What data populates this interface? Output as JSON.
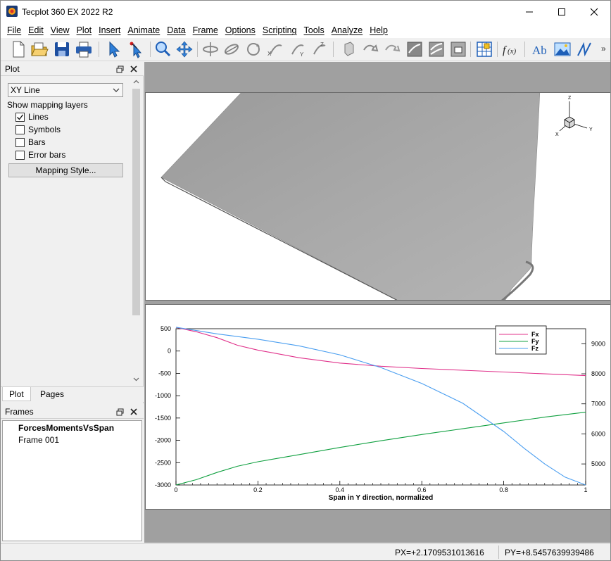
{
  "window": {
    "title": "Tecplot 360 EX 2022 R2"
  },
  "menu": [
    "File",
    "Edit",
    "View",
    "Plot",
    "Insert",
    "Animate",
    "Data",
    "Frame",
    "Options",
    "Scripting",
    "Tools",
    "Analyze",
    "Help"
  ],
  "toolbar": {
    "icons": [
      "new-layout-icon",
      "open-layout-icon",
      "save-layout-icon",
      "print-icon",
      "selector-icon",
      "adjustor-icon",
      "zoom-icon",
      "translate-icon",
      "rotate-x-icon",
      "rotate-y-icon",
      "roll-icon",
      "rotate-axis-x-icon",
      "rotate-axis-y-icon",
      "rotate-axis-z-icon",
      "probe-icon",
      "streamtrace-icon",
      "slice-icon",
      "contour-line-icon",
      "contour-flood-icon",
      "shade-icon",
      "geometry-icon",
      "grid-icon",
      "function-icon",
      "text-icon",
      "image-icon",
      "polyline-icon"
    ],
    "more": "»"
  },
  "plot_panel": {
    "title": "Plot",
    "plot_type": "XY Line",
    "show_layers_label": "Show mapping layers",
    "layers": [
      {
        "label": "Lines",
        "checked": true
      },
      {
        "label": "Symbols",
        "checked": false
      },
      {
        "label": "Bars",
        "checked": false
      },
      {
        "label": "Error bars",
        "checked": false
      }
    ],
    "mapping_style_label": "Mapping Style..."
  },
  "tabs": {
    "plot": "Plot",
    "pages": "Pages"
  },
  "frames_panel": {
    "title": "Frames",
    "page_name": "ForcesMomentsVsSpan",
    "frame_name": "Frame 001"
  },
  "axis_triad": {
    "x": "X",
    "y": "Y",
    "z": "Z"
  },
  "colors": {
    "fx": "#e0308a",
    "fy": "#10a040",
    "fz": "#4a9ef0",
    "wing": "#a8a8a8"
  },
  "chart_data": {
    "type": "line",
    "xlabel": "Span in Y direction, normalized",
    "xlim": [
      0,
      1
    ],
    "ylim": [
      -3000,
      500
    ],
    "y2lim": [
      4300,
      9500
    ],
    "xticks": [
      0,
      0.2,
      0.4,
      0.6,
      0.8,
      1
    ],
    "xtick_labels": [
      "0",
      "0.2",
      "0.4",
      "0.6",
      "0.8",
      "1"
    ],
    "yticks": [
      500,
      0,
      -500,
      -1000,
      -1500,
      -2000,
      -2500,
      -3000
    ],
    "y2ticks": [
      5000,
      6000,
      7000,
      8000,
      9000
    ],
    "legend_position": "top-right",
    "series": [
      {
        "name": "Fx",
        "axis": "left",
        "x": [
          0,
          0.05,
          0.1,
          0.15,
          0.2,
          0.3,
          0.4,
          0.5,
          0.6,
          0.7,
          0.8,
          0.9,
          1.0
        ],
        "y": [
          530,
          430,
          300,
          130,
          20,
          -150,
          -270,
          -340,
          -390,
          -430,
          -470,
          -510,
          -550
        ]
      },
      {
        "name": "Fy",
        "axis": "left",
        "x": [
          0,
          0.05,
          0.1,
          0.15,
          0.2,
          0.3,
          0.4,
          0.5,
          0.6,
          0.7,
          0.8,
          0.9,
          1.0
        ],
        "y": [
          -3000,
          -2880,
          -2720,
          -2580,
          -2480,
          -2320,
          -2160,
          -2010,
          -1870,
          -1740,
          -1610,
          -1480,
          -1370
        ]
      },
      {
        "name": "Fz",
        "axis": "right",
        "x": [
          0,
          0.1,
          0.2,
          0.3,
          0.4,
          0.5,
          0.6,
          0.7,
          0.8,
          0.85,
          0.9,
          0.95,
          1.0
        ],
        "y": [
          9550,
          9330,
          9150,
          8930,
          8630,
          8210,
          7680,
          7020,
          6080,
          5520,
          5000,
          4560,
          4300
        ]
      }
    ]
  },
  "status": {
    "px": "PX=+2.1709531013616",
    "py": "PY=+8.5457639939486"
  }
}
